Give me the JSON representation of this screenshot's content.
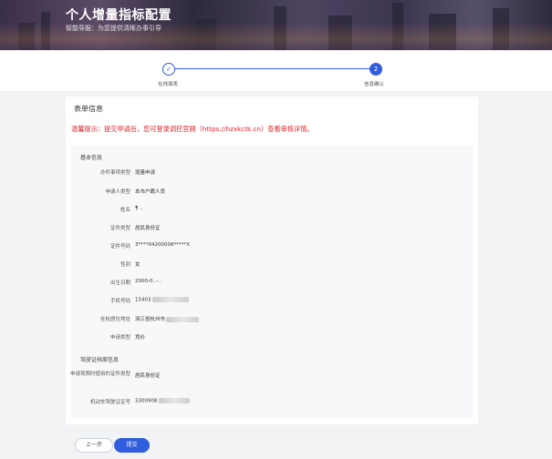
{
  "banner": {
    "title": "个人增量指标配置",
    "subtitle": "智能导服：为您提供清晰办事引导"
  },
  "steps": [
    {
      "label": "在线填表",
      "marker": "✓"
    },
    {
      "label": "信息确认",
      "marker": "2"
    }
  ],
  "form": {
    "title": "表单信息",
    "notice": "温馨提示：提交申请后，您可登录调控官网（https://hzxkctk.cn）查看审核详情。",
    "basic": {
      "title": "基本信息",
      "rows": [
        {
          "label": "办件事项类型",
          "value": "增量申请"
        },
        {
          "label": "申请人类型",
          "value": "本市户籍人员"
        },
        {
          "label": "姓名",
          "value": "¶ ‥"
        },
        {
          "label": "证件类型",
          "value": "居民身份证"
        },
        {
          "label": "证件号码",
          "value": "3****04200006*****X"
        },
        {
          "label": "性别",
          "value": "女"
        },
        {
          "label": "出生日期",
          "value": "2000-0‥-‥"
        },
        {
          "label": "手机号码",
          "value": "15403"
        },
        {
          "label": "在杭居住地址",
          "value": "浙江省杭州市"
        },
        {
          "label": "申请类型",
          "value": "竞价"
        }
      ]
    },
    "license": {
      "title": "驾驶证档案信息",
      "rows": [
        {
          "label": "申请驾照时使用的证件类型",
          "value": "居民身份证"
        },
        {
          "label": "机动车驾驶证证号",
          "value": "3300908"
        }
      ]
    }
  },
  "buttons": {
    "prev": "上一步",
    "submit": "提交"
  },
  "colors": {
    "primary": "#2f5dde",
    "notice": "#d9262c"
  }
}
